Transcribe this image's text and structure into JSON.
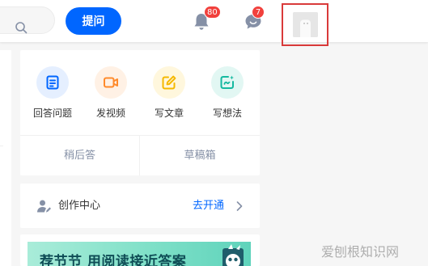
{
  "header": {
    "ask_button_label": "提问",
    "notifications_count": "80",
    "messages_count": "7"
  },
  "create": {
    "actions": [
      {
        "label": "回答问题",
        "icon": "answer-icon",
        "color": "#0066ff",
        "bg": "#e5efff"
      },
      {
        "label": "发视频",
        "icon": "video-icon",
        "color": "#ff8a2b",
        "bg": "#fff1e5"
      },
      {
        "label": "写文章",
        "icon": "article-icon",
        "color": "#f5b800",
        "bg": "#fff7dd"
      },
      {
        "label": "写想法",
        "icon": "idea-icon",
        "color": "#15b9a0",
        "bg": "#e2f7f3"
      }
    ],
    "later_label": "稍后答",
    "drafts_label": "草稿箱"
  },
  "creator": {
    "title": "创作中心",
    "link_label": "去开通"
  },
  "banner": {
    "text": "荐节节 用阅读接近答案"
  },
  "watermark": {
    "text": "爱刨根知识网"
  },
  "colors": {
    "brand_blue": "#0066ff",
    "badge_red": "#f1403c",
    "highlight_frame": "#d93a3a",
    "muted_text": "#8590a6"
  }
}
